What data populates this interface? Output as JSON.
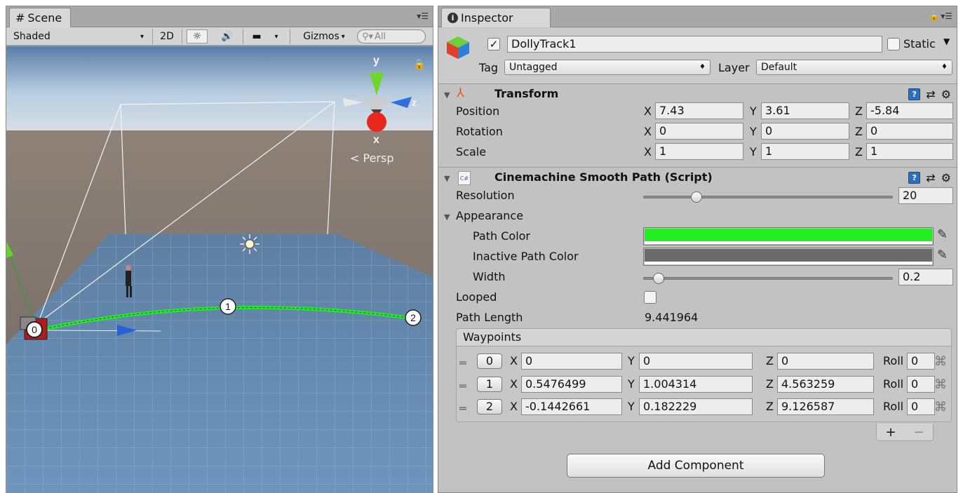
{
  "scene": {
    "tab_label": "Scene",
    "tab_icon": "#",
    "toolbar": {
      "shading_mode": "Shaded",
      "btn_2d": "2D",
      "gizmos_label": "Gizmos",
      "search_placeholder": "All"
    },
    "viewport": {
      "gizmo_y": "y",
      "gizmo_x": "x",
      "gizmo_z": "z",
      "persp_label": "Persp",
      "waypoint_markers": [
        "0",
        "1",
        "2"
      ]
    }
  },
  "inspector": {
    "tab_label": "Inspector",
    "gameobject": {
      "active": true,
      "name": "DollyTrack1",
      "static_label": "Static",
      "tag_label": "Tag",
      "tag_value": "Untagged",
      "layer_label": "Layer",
      "layer_value": "Default"
    },
    "transform": {
      "title": "Transform",
      "rows": [
        {
          "label": "Position",
          "x": "7.43",
          "y": "3.61",
          "z": "-5.84"
        },
        {
          "label": "Rotation",
          "x": "0",
          "y": "0",
          "z": "0"
        },
        {
          "label": "Scale",
          "x": "1",
          "y": "1",
          "z": "1"
        }
      ]
    },
    "smooth_path": {
      "title": "Cinemachine Smooth Path (Script)",
      "script_icon": "C#",
      "resolution_label": "Resolution",
      "resolution_value": "20",
      "resolution_slider_fraction": 0.2,
      "appearance_label": "Appearance",
      "path_color_label": "Path Color",
      "path_color": "#22ee22",
      "inactive_color_label": "Inactive Path Color",
      "inactive_color": "#6a6a6a",
      "width_label": "Width",
      "width_value": "0.2",
      "width_slider_fraction": 0.04,
      "looped_label": "Looped",
      "looped": false,
      "path_length_label": "Path Length",
      "path_length_value": "9.441964"
    },
    "waypoints": {
      "title": "Waypoints",
      "roll_label": "Roll",
      "rows": [
        {
          "index": "0",
          "x": "0",
          "y": "0",
          "z": "0",
          "roll": "0"
        },
        {
          "index": "1",
          "x": "0.5476499",
          "y": "1.004314",
          "z": "4.563259",
          "roll": "0"
        },
        {
          "index": "2",
          "x": "-0.1442661",
          "y": "0.182229",
          "z": "9.126587",
          "roll": "0"
        }
      ],
      "add_label": "+",
      "remove_label": "−"
    },
    "add_component_label": "Add Component"
  },
  "axis_labels": {
    "x": "X",
    "y": "Y",
    "z": "Z"
  }
}
